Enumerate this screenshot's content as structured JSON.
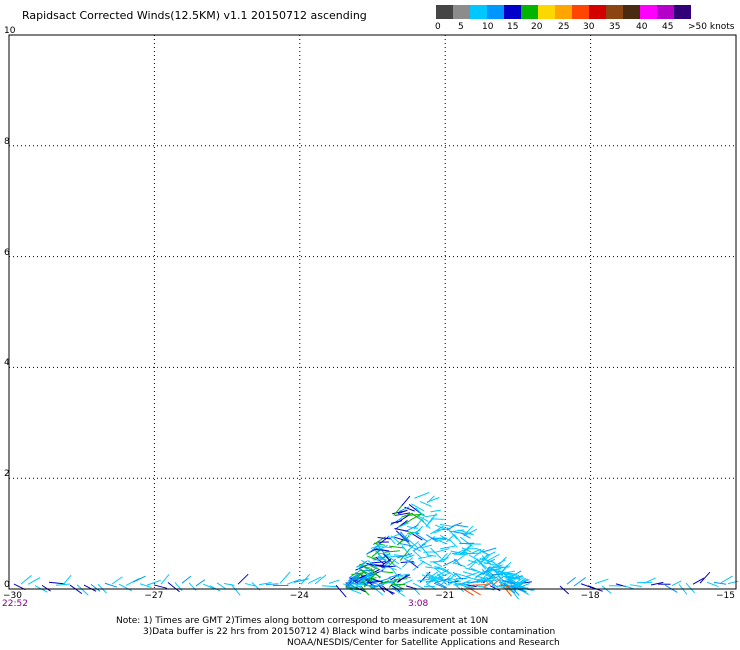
{
  "title": "Rapidsact Corrected Winds(12.5KM) v1.1 20150712 ascending",
  "color_scale": {
    "swatches": [
      "#454545",
      "#8c8c8c",
      "#00c8ff",
      "#0096ff",
      "#0000c8",
      "#00b400",
      "#ffd700",
      "#ffa500",
      "#ff4500",
      "#d20000",
      "#8b4513",
      "#4a2a10",
      "#ff00ff",
      "#b400c8",
      "#320078"
    ],
    "labels": [
      "0",
      "5",
      "10",
      "15",
      "20",
      "25",
      "30",
      "35",
      "40",
      "45",
      ">50 knots"
    ]
  },
  "axes": {
    "x_ticks": [
      "-30",
      "-27",
      "-24",
      "-21",
      "-18",
      "-15"
    ],
    "y_ticks": [
      "0",
      "2",
      "4",
      "6",
      "8",
      "10"
    ],
    "times": [
      "22:52",
      "3:08"
    ]
  },
  "chart_data": {
    "type": "scatter",
    "description_of_marks": "wind barbs",
    "xlim": [
      -30,
      -15
    ],
    "ylim": [
      0,
      10
    ],
    "grid": true
  },
  "note": {
    "line1": "Note: 1) Times are GMT 2)Times along bottom correspond to measurement at 10N",
    "line2": "3)Data buffer is 22 hrs from 20150712 4) Black wind barbs indicate possible contamination",
    "line3": "NOAA/NESDIS/Center for Satellite Applications and Research"
  }
}
